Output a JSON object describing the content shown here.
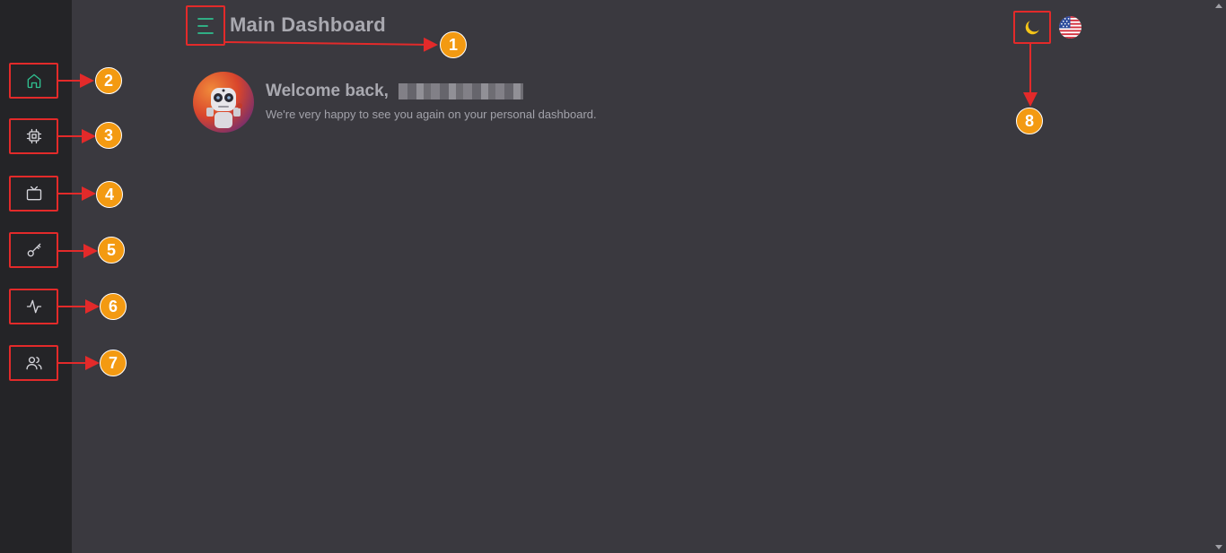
{
  "header": {
    "title": "Main Dashboard",
    "menu_icon": "menu-icon"
  },
  "sidebar": {
    "items": [
      {
        "icon": "home-icon",
        "active": true
      },
      {
        "icon": "chip-icon"
      },
      {
        "icon": "tv-icon"
      },
      {
        "icon": "key-icon"
      },
      {
        "icon": "activity-icon"
      },
      {
        "icon": "users-icon"
      }
    ]
  },
  "welcome": {
    "title": "Welcome back,",
    "subtitle": "We're very happy to see you again on your personal dashboard."
  },
  "toolbar": {
    "theme_icon": "moon-icon",
    "language_icon": "us-flag-icon"
  },
  "annotations": [
    "1",
    "2",
    "3",
    "4",
    "5",
    "6",
    "7",
    "8"
  ],
  "colors": {
    "accent": "#2fbf8f",
    "background": "#3a393f",
    "sidebar": "#242427",
    "highlight_box": "#e32a2a",
    "callout": "#f39a12",
    "moon": "#f5c518"
  }
}
